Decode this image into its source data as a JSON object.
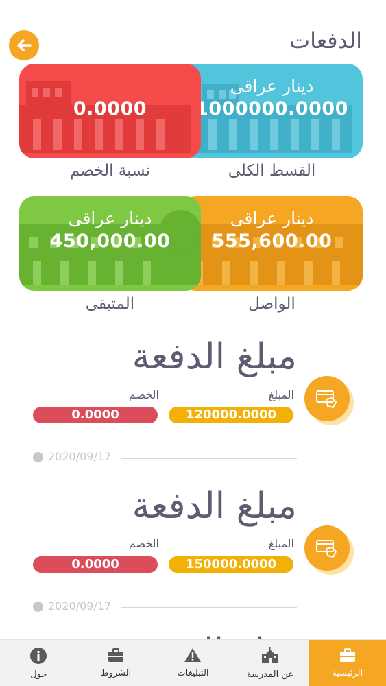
{
  "header": {
    "title": "الدفعات",
    "back_icon": "arrow-left-icon"
  },
  "cards": [
    {
      "id": "total",
      "currency": "دينار عراقى",
      "amount": "1000000.0000",
      "label": "القسط الكلى",
      "color": "#52c4dc"
    },
    {
      "id": "discount",
      "currency": "",
      "amount": "0.0000",
      "label": "نسبة الخصم",
      "color": "#f54b4b"
    },
    {
      "id": "paid",
      "currency": "دينار عراقى",
      "amount": "555,600.00",
      "label": "الواصل",
      "color": "#f5a623"
    },
    {
      "id": "remaining",
      "currency": "دينار عراقى",
      "amount": "450,000.00",
      "label": "المتبقى",
      "color": "#7ec843"
    }
  ],
  "payments": [
    {
      "title": "مبلغ الدفعة",
      "amount_label": "المبلغ",
      "amount": "120000.0000",
      "discount_label": "الخصم",
      "discount": "0.0000",
      "date": "2020/09/17",
      "icon": "card-payment-icon"
    },
    {
      "title": "مبلغ الدفعة",
      "amount_label": "المبلغ",
      "amount": "150000.0000",
      "discount_label": "الخصم",
      "discount": "0.0000",
      "date": "2020/09/17",
      "icon": "card-payment-icon"
    }
  ],
  "partial_payment_title": "مبلغ الدفعة",
  "tabs": [
    {
      "label": "الرئيسية",
      "icon": "briefcase-icon",
      "active": true
    },
    {
      "label": "عن المدرسة",
      "icon": "school-icon",
      "active": false
    },
    {
      "label": "التبليغات",
      "icon": "warning-icon",
      "active": false
    },
    {
      "label": "الشروط",
      "icon": "briefcase-icon",
      "active": false
    },
    {
      "label": "حول",
      "icon": "info-icon",
      "active": false
    }
  ],
  "colors": {
    "accent": "#f5a623",
    "text": "#5c5d72",
    "amount_pill": "#f2b106",
    "discount_pill": "#db4d5a"
  }
}
